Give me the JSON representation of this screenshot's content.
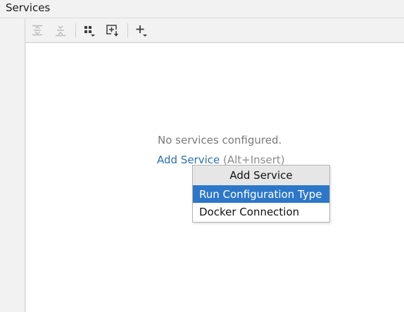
{
  "window": {
    "title": "Services"
  },
  "toolbar": {
    "buttons": [
      {
        "icon": "expand-all-icon",
        "enabled": false
      },
      {
        "icon": "collapse-all-icon",
        "enabled": false
      },
      {
        "icon": "group-by-icon",
        "enabled": true
      },
      {
        "icon": "new-tab-icon",
        "enabled": true
      },
      {
        "icon": "add-icon",
        "enabled": true
      }
    ]
  },
  "main": {
    "empty_text": "No services configured.",
    "add_link": "Add Service",
    "add_shortcut": "(Alt+Insert)"
  },
  "popup": {
    "title": "Add Service",
    "items": [
      {
        "label": "Run Configuration Type",
        "selected": true
      },
      {
        "label": "Docker Connection",
        "selected": false
      }
    ]
  },
  "colors": {
    "link": "#2a6fb3",
    "selection": "#2d77c9",
    "icon": "#3c3c3c",
    "icon_disabled": "#b8b8b8"
  }
}
